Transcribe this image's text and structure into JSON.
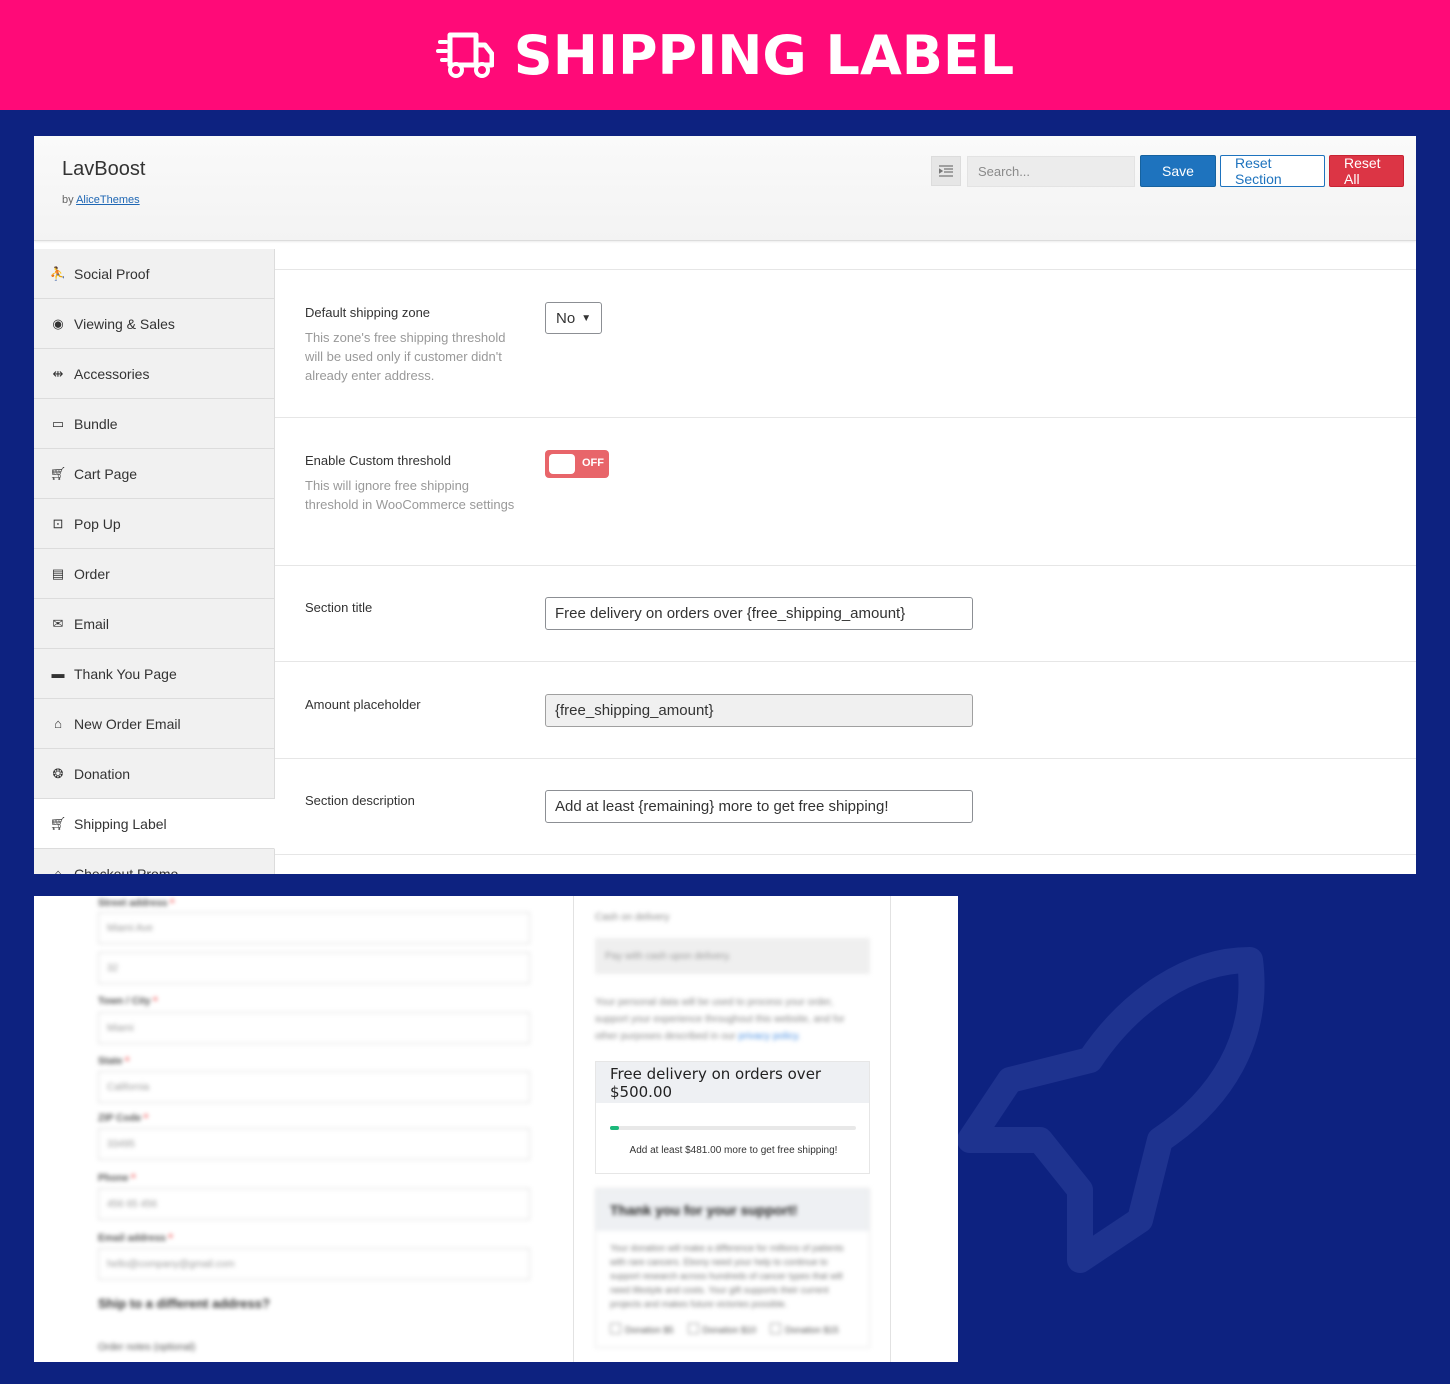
{
  "banner": {
    "title": "SHIPPING LABEL",
    "icon": "delivery-truck-icon"
  },
  "header": {
    "app_name": "LavBoost",
    "by_label": "by",
    "author": "AliceThemes",
    "search_placeholder": "Search...",
    "save_label": "Save",
    "reset_section_label": "Reset Section",
    "reset_all_label": "Reset All",
    "colors": {
      "save": "#1e73be",
      "reset_all": "#dc3545"
    }
  },
  "sidebar": {
    "items": [
      {
        "label": "Social Proof",
        "icon": "people-icon"
      },
      {
        "label": "Viewing & Sales",
        "icon": "eye-icon"
      },
      {
        "label": "Accessories",
        "icon": "usb-icon"
      },
      {
        "label": "Bundle",
        "icon": "laptop-icon"
      },
      {
        "label": "Cart Page",
        "icon": "cart-icon"
      },
      {
        "label": "Pop Up",
        "icon": "popup-icon"
      },
      {
        "label": "Order",
        "icon": "document-icon"
      },
      {
        "label": "Email",
        "icon": "envelope-icon"
      },
      {
        "label": "Thank You Page",
        "icon": "card-icon"
      },
      {
        "label": "New Order Email",
        "icon": "store-icon"
      },
      {
        "label": "Donation",
        "icon": "donation-icon"
      },
      {
        "label": "Shipping Label",
        "icon": "cart-icon",
        "active": true
      },
      {
        "label": "Checkout Promo",
        "icon": "store-icon"
      }
    ]
  },
  "settings": {
    "default_zone": {
      "label": "Default shipping zone",
      "desc": "This zone's free shipping threshold will be used only if customer didn't already enter address.",
      "value": "No"
    },
    "custom_threshold": {
      "label": "Enable Custom threshold",
      "desc": "This will ignore free shipping threshold in WooCommerce settings",
      "state": "OFF"
    },
    "section_title": {
      "label": "Section title",
      "value": "Free delivery on orders over {free_shipping_amount}"
    },
    "amount_placeholder": {
      "label": "Amount placeholder",
      "value": "{free_shipping_amount}"
    },
    "section_description": {
      "label": "Section description",
      "value": "Add at least {remaining} more to get free shipping!"
    }
  },
  "preview": {
    "free_shipping": {
      "title": "Free delivery on orders over $500.00",
      "desc": "Add at least $481.00 more to get free shipping!",
      "progress_fraction": 0.038,
      "bar_color": "#1bb87a"
    },
    "blurred": {
      "street_label": "Street address",
      "street_value": "Miami Ave",
      "street_value2": "32",
      "city_label": "Town / City",
      "city_value": "Miami",
      "state_label": "State",
      "state_value": "California",
      "zip_label": "ZIP Code",
      "zip_value": "33495",
      "phone_label": "Phone",
      "phone_value": "456 65 456",
      "email_label": "Email address",
      "email_value": "hello@company@gmail.com",
      "ship_diff": "Ship to a different address?",
      "order_notes": "Order notes (optional)",
      "cod": "Cash on delivery",
      "cod_desc": "Pay with cash upon delivery.",
      "privacy": "Your personal data will be used to process your order, support your experience throughout this website, and for other purposes described in our",
      "privacy_link": "privacy policy.",
      "donation_title": "Thank you for your support!",
      "donation_text": "Your donation will make a difference for millions of patients with rare cancers. Ebony need your help to continue to support research across hundreds of cancer types that will need lifestyle and costs. Your gift supports their current projects and makes future victories possible.",
      "donation_opts": [
        "Donation $5",
        "Donation $10",
        "Donation $15"
      ]
    }
  }
}
